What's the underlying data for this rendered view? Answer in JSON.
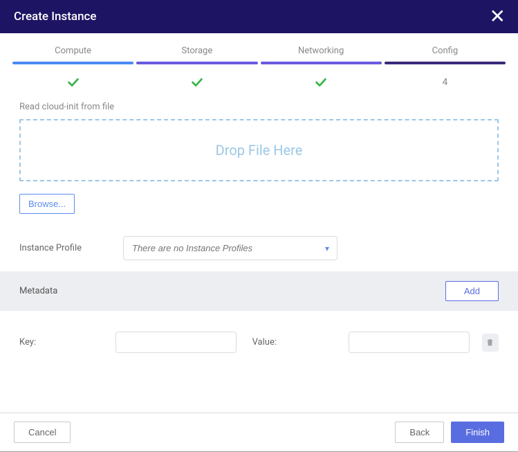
{
  "header": {
    "title": "Create Instance"
  },
  "steps": [
    {
      "label": "Compute",
      "done": true
    },
    {
      "label": "Storage",
      "done": true
    },
    {
      "label": "Networking",
      "done": true
    },
    {
      "label": "Config",
      "done": false,
      "number": "4"
    }
  ],
  "cloudInit": {
    "label": "Read cloud-init from file",
    "dropText": "Drop File Here",
    "browse": "Browse..."
  },
  "instanceProfile": {
    "label": "Instance Profile",
    "placeholder": "There are no Instance Profiles"
  },
  "metadata": {
    "title": "Metadata",
    "add": "Add",
    "keyLabel": "Key:",
    "valueLabel": "Value:",
    "rows": [
      {
        "key": "",
        "value": ""
      }
    ]
  },
  "footer": {
    "cancel": "Cancel",
    "back": "Back",
    "finish": "Finish"
  }
}
